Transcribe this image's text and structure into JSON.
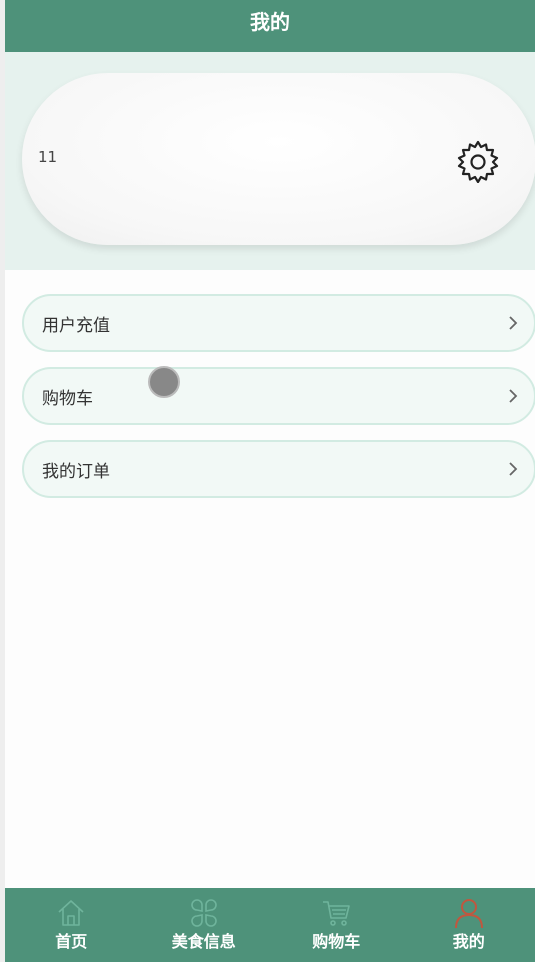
{
  "header": {
    "title": "我的"
  },
  "profile": {
    "name": "11",
    "settings_icon": "gear-icon"
  },
  "menu": {
    "items": [
      {
        "label": "用户充值",
        "icon": "chevron-right-icon"
      },
      {
        "label": "购物车",
        "icon": "chevron-right-icon"
      },
      {
        "label": "我的订单",
        "icon": "chevron-right-icon"
      }
    ]
  },
  "tabbar": {
    "items": [
      {
        "label": "首页",
        "icon": "home-icon"
      },
      {
        "label": "美食信息",
        "icon": "grid-icon"
      },
      {
        "label": "购物车",
        "icon": "cart-icon"
      },
      {
        "label": "我的",
        "icon": "user-icon",
        "active": true
      }
    ],
    "active_icon_color": "#c0573f",
    "inactive_icon_color": "#6fb49c"
  },
  "colors": {
    "primary": "#4e927a",
    "band": "#e6f2ee",
    "item_bg": "#f2f9f6",
    "item_border": "#d2ebe2"
  }
}
